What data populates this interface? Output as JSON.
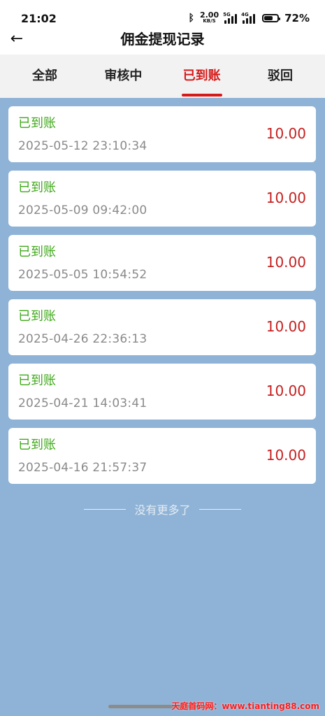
{
  "status_bar": {
    "time": "21:02",
    "speed_value": "2.00",
    "speed_unit": "KB/S",
    "signal_1_tag": "5G",
    "signal_2_tag": "4G",
    "battery_percent": 72,
    "battery_text": "72%"
  },
  "header": {
    "title": "佣金提现记录"
  },
  "tabs": [
    {
      "label": "全部",
      "active": false
    },
    {
      "label": "审核中",
      "active": false
    },
    {
      "label": "已到账",
      "active": true
    },
    {
      "label": "驳回",
      "active": false
    }
  ],
  "records": [
    {
      "status": "已到账",
      "time": "2025-05-12 23:10:34",
      "amount": "10.00"
    },
    {
      "status": "已到账",
      "time": "2025-05-09 09:42:00",
      "amount": "10.00"
    },
    {
      "status": "已到账",
      "time": "2025-05-05 10:54:52",
      "amount": "10.00"
    },
    {
      "status": "已到账",
      "time": "2025-04-26 22:36:13",
      "amount": "10.00"
    },
    {
      "status": "已到账",
      "time": "2025-04-21 14:03:41",
      "amount": "10.00"
    },
    {
      "status": "已到账",
      "time": "2025-04-16 21:57:37",
      "amount": "10.00"
    }
  ],
  "footer": {
    "no_more_text": "没有更多了",
    "watermark_text": "天庭首码网：www.tianting88.com"
  },
  "colors": {
    "accent_red": "#d61919",
    "status_green": "#3fa91a",
    "amount_red": "#c61e1e",
    "page_bg": "#8fb3d6"
  },
  "icons": {
    "back": "arrow-left-icon",
    "bluetooth": "bluetooth-icon",
    "signal": "signal-icon",
    "battery": "battery-icon"
  }
}
